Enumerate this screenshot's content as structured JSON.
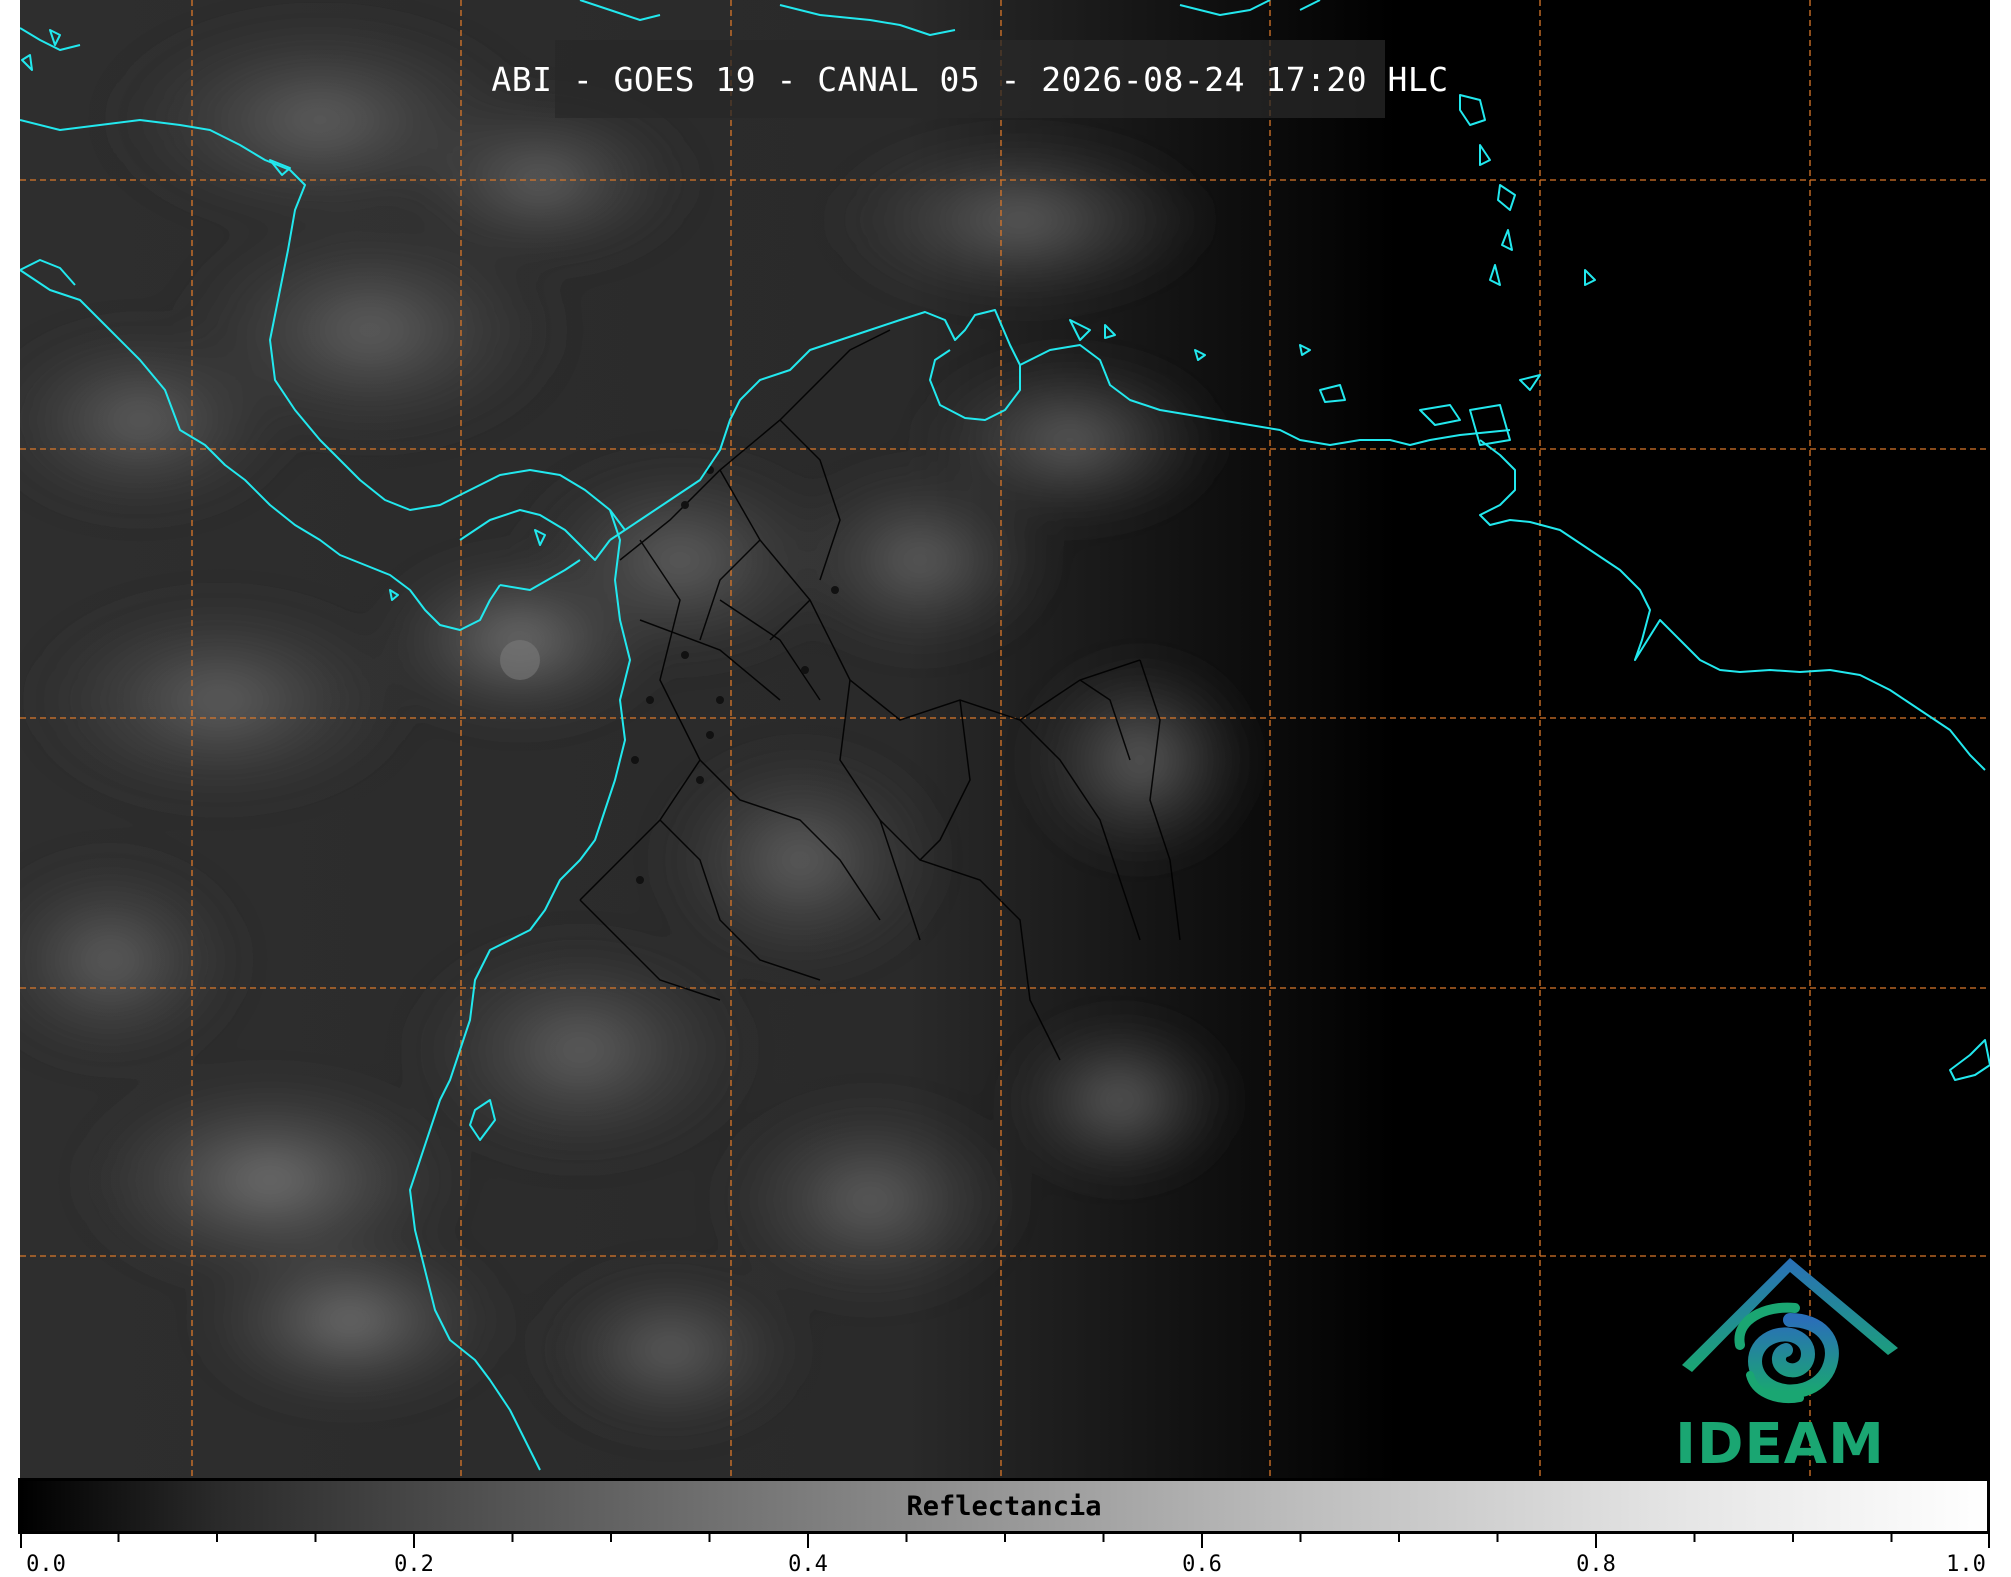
{
  "title": "ABI - GOES 19 - CANAL 05 - 2026-08-24 17:20 HLC",
  "colorbar": {
    "label": "Reflectancia",
    "range": [
      0.0,
      1.0
    ],
    "major_ticks": [
      "0.0",
      "0.2",
      "0.4",
      "0.6",
      "0.8",
      "1.0"
    ],
    "colormap": "grayscale black-to-white"
  },
  "logo": {
    "text": "IDEAM",
    "color": "#1aa672",
    "accent": "#2a7fb8"
  },
  "map": {
    "coastline_color": "#22e8ee",
    "grid_color": "#d9772a",
    "border_color": "#000000",
    "background": "satellite visible reflectance, dark"
  }
}
